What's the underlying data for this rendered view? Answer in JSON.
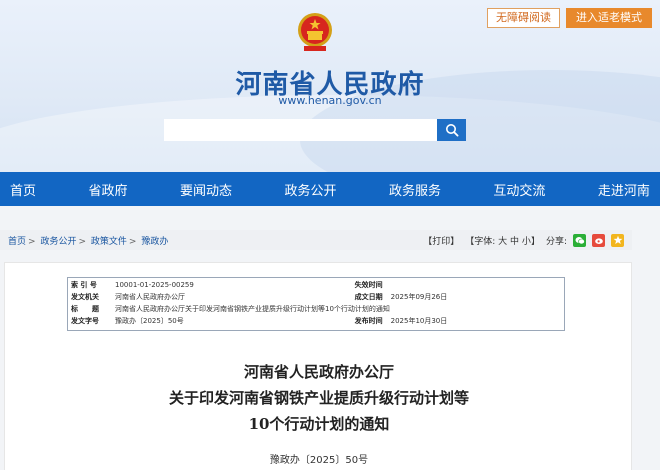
{
  "top_buttons": {
    "accessibility": "无障碍阅读",
    "elder_mode": "进入适老模式"
  },
  "site": {
    "title": "河南省人民政府",
    "url": "www.henan.gov.cn"
  },
  "search": {
    "placeholder": ""
  },
  "nav": [
    "首页",
    "省政府",
    "要闻动态",
    "政务公开",
    "政务服务",
    "互动交流",
    "走进河南"
  ],
  "breadcrumb": [
    "首页",
    "政务公开",
    "政策文件",
    "豫政办"
  ],
  "tools": {
    "print": "【打印】",
    "font_label": "【字体:",
    "font_large": "大",
    "font_medium": "中",
    "font_small": "小",
    "font_end": "】",
    "share": "分享:"
  },
  "colors": {
    "nav_bg": "#1266c3",
    "title_blue": "#1f5aa6",
    "elder_btn": "#e8892c"
  },
  "meta": {
    "index_label": "索 引 号",
    "index_value": "10001-01-2025-00259",
    "expire_label": "失效时间",
    "expire_value": "",
    "issuer_label": "发文机关",
    "issuer_value": "河南省人民政府办公厅",
    "date_label": "成文日期",
    "date_value": "2025年09月26日",
    "subject_label": "标　　题",
    "subject_value": "河南省人民政府办公厅关于印发河南省钢铁产业提质升级行动计划等10个行动计划的通知",
    "docno_label": "发文字号",
    "docno_value": "豫政办〔2025〕50号",
    "publish_label": "发布时间",
    "publish_value": "2025年10月30日"
  },
  "document": {
    "title_line1": "河南省人民政府办公厅",
    "title_line2": "关于印发河南省钢铁产业提质升级行动计划等",
    "title_line3": "10个行动计划的通知",
    "doc_number": "豫政办〔2025〕50号"
  }
}
